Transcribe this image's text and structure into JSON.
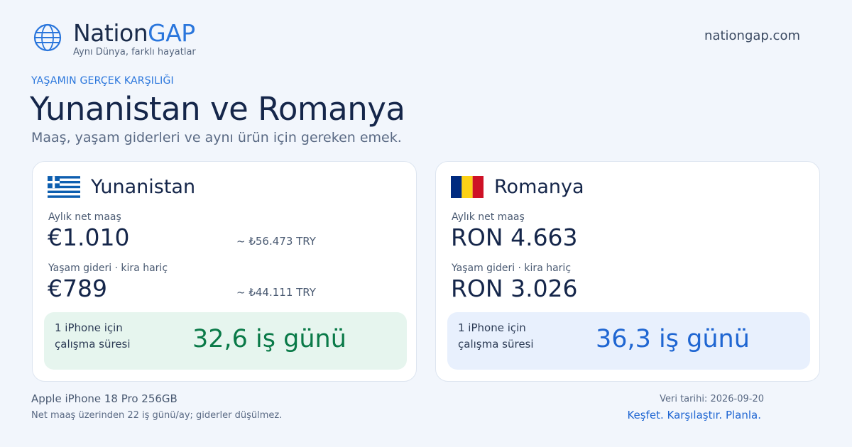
{
  "header": {
    "brand_part1": "Nation",
    "brand_part2": "GAP",
    "tagline": "Aynı Dünya, farklı hayatlar",
    "site": "nationgap.com",
    "logo_icon": "globe-icon"
  },
  "hero": {
    "eyebrow": "YAŞAMIN GERÇEK KARŞILIĞI",
    "title": "Yunanistan ve Romanya",
    "subtitle": "Maaş, yaşam giderleri ve aynı ürün için gereken emek."
  },
  "countries": [
    {
      "name": "Yunanistan",
      "flag_icon": "greece-flag-icon",
      "salary_label": "Aylık net maaş",
      "salary_value": "€1.010",
      "salary_conv": "~ ₺56.473 TRY",
      "cost_label": "Yaşam gideri · kira hariç",
      "cost_value": "€789",
      "cost_conv": "~ ₺44.111 TRY",
      "work_label_line1": "1 iPhone için",
      "work_label_line2": "çalışma süresi",
      "work_value": "32,6 iş günü",
      "accent": "#0a7a48"
    },
    {
      "name": "Romanya",
      "flag_icon": "romania-flag-icon",
      "salary_label": "Aylık net maaş",
      "salary_value": "RON 4.663",
      "cost_label": "Yaşam gideri · kira hariç",
      "cost_value": "RON 3.026",
      "work_label_line1": "1 iPhone için",
      "work_label_line2": "çalışma süresi",
      "work_value": "36,3 iş günü",
      "accent": "#1f66d2"
    }
  ],
  "footer": {
    "product": "Apple iPhone 18 Pro 256GB",
    "note": "Net maaş üzerinden 22 iş günü/ay; giderler düşülmez.",
    "date": "Veri tarihi: 2026-09-20",
    "cta": "Keşfet. Karşılaştır. Planla."
  },
  "colors": {
    "background": "#f2f6fc",
    "brand_accent": "#2a76dc",
    "text_dark": "#15264a"
  }
}
